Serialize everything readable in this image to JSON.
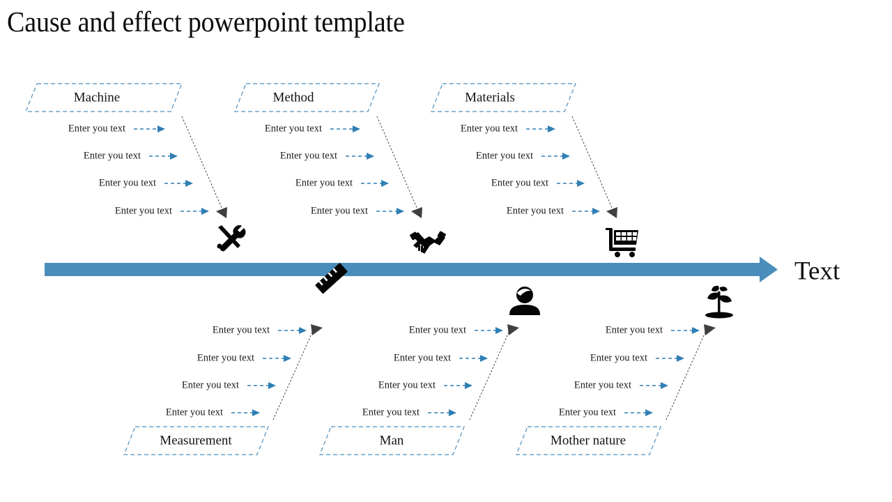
{
  "page": {
    "title": "Cause and effect powerpoint template",
    "background_color": "#ffffff"
  },
  "colors": {
    "accent_blue": "#4a8dba",
    "border_blue": "#4a8fc0",
    "arrow_blue": "#2f7fb5",
    "bone_gray": "#4a4a4a",
    "icon_black": "#050505",
    "text_black": "#111111"
  },
  "spine": {
    "effect_label": "Text",
    "bar_color": "#4a8dba",
    "direction": "right"
  },
  "entry_placeholder": "Enter you text",
  "categories": [
    {
      "id": "machine",
      "label": "Machine",
      "position": "top",
      "icon": "tools-icon",
      "entries": [
        "Enter you text",
        "Enter you text",
        "Enter you text",
        "Enter you text"
      ]
    },
    {
      "id": "method",
      "label": "Method",
      "position": "top",
      "icon": "handshake-icon",
      "entries": [
        "Enter you text",
        "Enter you text",
        "Enter you text",
        "Enter you text"
      ]
    },
    {
      "id": "materials",
      "label": "Materials",
      "position": "top",
      "icon": "shopping-cart-icon",
      "entries": [
        "Enter you text",
        "Enter you text",
        "Enter you text",
        "Enter you text"
      ]
    },
    {
      "id": "measurement",
      "label": "Measurement",
      "position": "bottom",
      "icon": "ruler-icon",
      "entries": [
        "Enter you text",
        "Enter you text",
        "Enter you text",
        "Enter you text"
      ]
    },
    {
      "id": "man",
      "label": "Man",
      "position": "bottom",
      "icon": "person-icon",
      "entries": [
        "Enter you text",
        "Enter you text",
        "Enter you text",
        "Enter you text"
      ]
    },
    {
      "id": "mother-nature",
      "label": "Mother nature",
      "position": "bottom",
      "icon": "plant-icon",
      "entries": [
        "Enter you text",
        "Enter you text",
        "Enter you text",
        "Enter you text"
      ]
    }
  ]
}
